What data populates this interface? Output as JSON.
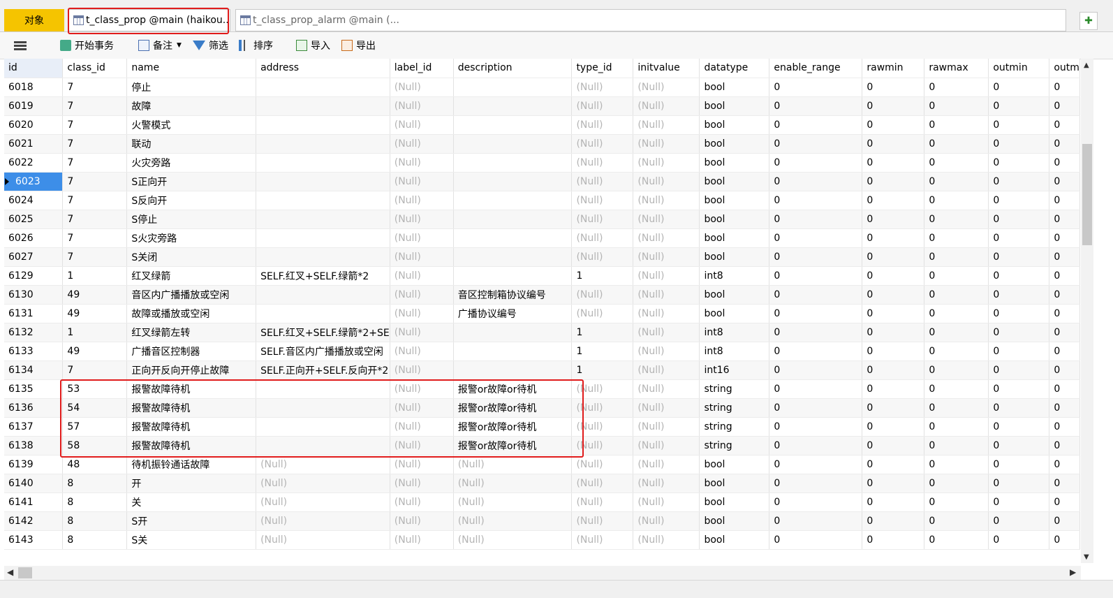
{
  "tabs": {
    "objects_label": "对象",
    "active": "t_class_prop @main (haikou...",
    "inactive": "t_class_prop_alarm @main (..."
  },
  "toolbar": {
    "begin_tx": "开始事务",
    "note": "备注",
    "filter": "筛选",
    "sort": "排序",
    "import": "导入",
    "export": "导出"
  },
  "grid": {
    "columns": [
      "id",
      "class_id",
      "name",
      "address",
      "label_id",
      "description",
      "type_id",
      "initvalue",
      "datatype",
      "enable_range",
      "rawmin",
      "rawmax",
      "outmin",
      "outm"
    ],
    "selected_id": "6023",
    "rows": [
      [
        "6018",
        "7",
        "停止",
        "",
        "(Null)",
        "",
        "(Null)",
        "(Null)",
        "bool",
        "0",
        "0",
        "0",
        "0",
        "0"
      ],
      [
        "6019",
        "7",
        "故障",
        "",
        "(Null)",
        "",
        "(Null)",
        "(Null)",
        "bool",
        "0",
        "0",
        "0",
        "0",
        "0"
      ],
      [
        "6020",
        "7",
        "火警模式",
        "",
        "(Null)",
        "",
        "(Null)",
        "(Null)",
        "bool",
        "0",
        "0",
        "0",
        "0",
        "0"
      ],
      [
        "6021",
        "7",
        "联动",
        "",
        "(Null)",
        "",
        "(Null)",
        "(Null)",
        "bool",
        "0",
        "0",
        "0",
        "0",
        "0"
      ],
      [
        "6022",
        "7",
        "火灾旁路",
        "",
        "(Null)",
        "",
        "(Null)",
        "(Null)",
        "bool",
        "0",
        "0",
        "0",
        "0",
        "0"
      ],
      [
        "6023",
        "7",
        "S正向开",
        "",
        "(Null)",
        "",
        "(Null)",
        "(Null)",
        "bool",
        "0",
        "0",
        "0",
        "0",
        "0"
      ],
      [
        "6024",
        "7",
        "S反向开",
        "",
        "(Null)",
        "",
        "(Null)",
        "(Null)",
        "bool",
        "0",
        "0",
        "0",
        "0",
        "0"
      ],
      [
        "6025",
        "7",
        "S停止",
        "",
        "(Null)",
        "",
        "(Null)",
        "(Null)",
        "bool",
        "0",
        "0",
        "0",
        "0",
        "0"
      ],
      [
        "6026",
        "7",
        "S火灾旁路",
        "",
        "(Null)",
        "",
        "(Null)",
        "(Null)",
        "bool",
        "0",
        "0",
        "0",
        "0",
        "0"
      ],
      [
        "6027",
        "7",
        "S关闭",
        "",
        "(Null)",
        "",
        "(Null)",
        "(Null)",
        "bool",
        "0",
        "0",
        "0",
        "0",
        "0"
      ],
      [
        "6129",
        "1",
        "红叉绿箭",
        "SELF.红叉+SELF.绿箭*2",
        "(Null)",
        "",
        "1",
        "(Null)",
        "int8",
        "0",
        "0",
        "0",
        "0",
        "0"
      ],
      [
        "6130",
        "49",
        "音区内广播播放或空闲",
        "",
        "(Null)",
        "音区控制箱协议编号",
        "(Null)",
        "(Null)",
        "bool",
        "0",
        "0",
        "0",
        "0",
        "0"
      ],
      [
        "6131",
        "49",
        "故障或播放或空闲",
        "",
        "(Null)",
        "广播协议编号",
        "(Null)",
        "(Null)",
        "bool",
        "0",
        "0",
        "0",
        "0",
        "0"
      ],
      [
        "6132",
        "1",
        "红叉绿箭左转",
        "SELF.红叉+SELF.绿箭*2+SE",
        "(Null)",
        "",
        "1",
        "(Null)",
        "int8",
        "0",
        "0",
        "0",
        "0",
        "0"
      ],
      [
        "6133",
        "49",
        "广播音区控制器",
        "SELF.音区内广播播放或空闲",
        "(Null)",
        "",
        "1",
        "(Null)",
        "int8",
        "0",
        "0",
        "0",
        "0",
        "0"
      ],
      [
        "6134",
        "7",
        "正向开反向开停止故障",
        "SELF.正向开+SELF.反向开*2",
        "(Null)",
        "",
        "1",
        "(Null)",
        "int16",
        "0",
        "0",
        "0",
        "0",
        "0"
      ],
      [
        "6135",
        "53",
        "报警故障待机",
        "",
        "(Null)",
        "报警or故障or待机",
        "(Null)",
        "(Null)",
        "string",
        "0",
        "0",
        "0",
        "0",
        "0"
      ],
      [
        "6136",
        "54",
        "报警故障待机",
        "",
        "(Null)",
        "报警or故障or待机",
        "(Null)",
        "(Null)",
        "string",
        "0",
        "0",
        "0",
        "0",
        "0"
      ],
      [
        "6137",
        "57",
        "报警故障待机",
        "",
        "(Null)",
        "报警or故障or待机",
        "(Null)",
        "(Null)",
        "string",
        "0",
        "0",
        "0",
        "0",
        "0"
      ],
      [
        "6138",
        "58",
        "报警故障待机",
        "",
        "(Null)",
        "报警or故障or待机",
        "(Null)",
        "(Null)",
        "string",
        "0",
        "0",
        "0",
        "0",
        "0"
      ],
      [
        "6139",
        "48",
        "待机振铃通话故障",
        "(Null)",
        "(Null)",
        "(Null)",
        "(Null)",
        "(Null)",
        "bool",
        "0",
        "0",
        "0",
        "0",
        "0"
      ],
      [
        "6140",
        "8",
        "开",
        "(Null)",
        "(Null)",
        "(Null)",
        "(Null)",
        "(Null)",
        "bool",
        "0",
        "0",
        "0",
        "0",
        "0"
      ],
      [
        "6141",
        "8",
        "关",
        "(Null)",
        "(Null)",
        "(Null)",
        "(Null)",
        "(Null)",
        "bool",
        "0",
        "0",
        "0",
        "0",
        "0"
      ],
      [
        "6142",
        "8",
        "S开",
        "(Null)",
        "(Null)",
        "(Null)",
        "(Null)",
        "(Null)",
        "bool",
        "0",
        "0",
        "0",
        "0",
        "0"
      ],
      [
        "6143",
        "8",
        "S关",
        "(Null)",
        "(Null)",
        "(Null)",
        "(Null)",
        "(Null)",
        "bool",
        "0",
        "0",
        "0",
        "0",
        "0"
      ]
    ]
  },
  "colors": {
    "objects_tab": "#f5c400",
    "selection": "#3d8ee8",
    "null_text": "#b4b4b4",
    "highlight": "#e01b1b"
  }
}
